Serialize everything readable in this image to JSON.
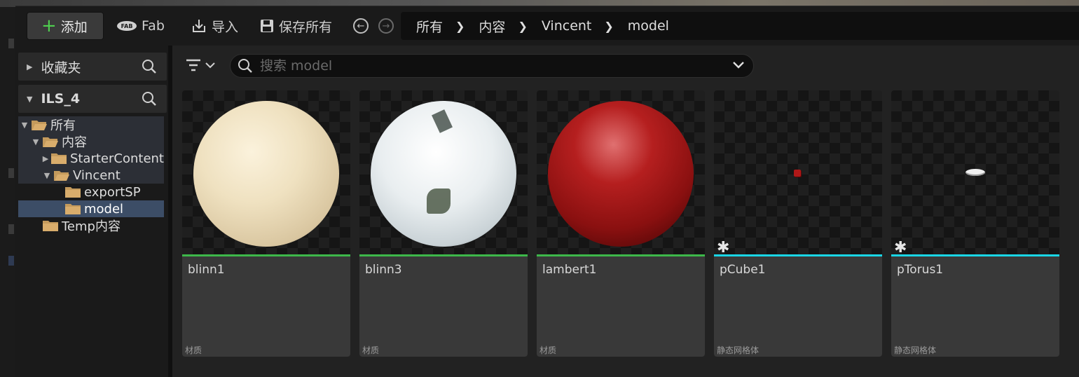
{
  "toolbar": {
    "add_label": "添加",
    "fab_label": "Fab",
    "import_label": "导入",
    "save_all_label": "保存所有"
  },
  "breadcrumb": [
    "所有",
    "内容",
    "Vincent",
    "model"
  ],
  "left_panel": {
    "favorites_label": "收藏夹",
    "project_label": "ILS_4",
    "tree": [
      {
        "label": "所有",
        "expanded": true
      },
      {
        "label": "内容",
        "expanded": true
      },
      {
        "label": "StarterContent",
        "expanded": false
      },
      {
        "label": "Vincent",
        "expanded": true
      },
      {
        "label": "exportSP"
      },
      {
        "label": "model",
        "selected": true
      },
      {
        "label": "Temp内容"
      }
    ]
  },
  "search": {
    "placeholder": "搜索 model"
  },
  "assets": [
    {
      "name": "blinn1",
      "type": "材质",
      "bar_color": "#3db84a",
      "preview": "cream-sphere"
    },
    {
      "name": "blinn3",
      "type": "材质",
      "bar_color": "#3db84a",
      "preview": "white-sphere"
    },
    {
      "name": "lambert1",
      "type": "材质",
      "bar_color": "#3db84a",
      "preview": "red-sphere"
    },
    {
      "name": "pCube1",
      "type": "静态网格体",
      "bar_color": "#19d6e6",
      "preview": "tiny-cube"
    },
    {
      "name": "pTorus1",
      "type": "静态网格体",
      "bar_color": "#19d6e6",
      "preview": "tiny-torus"
    }
  ],
  "colors": {
    "accent_material": "#3db84a",
    "accent_mesh": "#19d6e6",
    "selection": "#3c4d66",
    "add_plus": "#4fcf4f"
  }
}
